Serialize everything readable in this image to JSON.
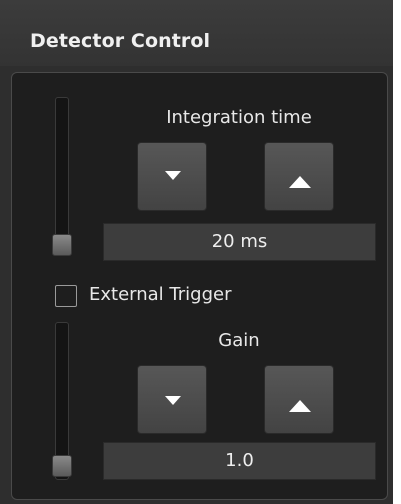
{
  "panel": {
    "title": "Detector Control",
    "colors": {
      "background": "#1e1e1e",
      "header": "#333333",
      "button": "#4d4d4d",
      "text": "#e8e8e8"
    }
  },
  "integration": {
    "label": "Integration time",
    "value": "20 ms",
    "decrease_icon": "triangle-down-icon",
    "increase_icon": "triangle-up-icon",
    "slider_level": 0.0
  },
  "external_trigger": {
    "label": "External Trigger",
    "checked": false
  },
  "gain": {
    "label": "Gain",
    "value": "1.0",
    "decrease_icon": "triangle-down-icon",
    "increase_icon": "triangle-up-icon",
    "slider_level": 0.0
  }
}
